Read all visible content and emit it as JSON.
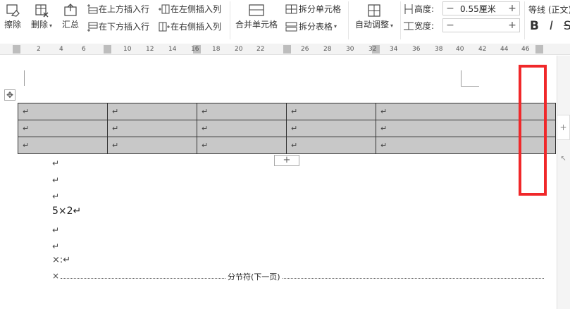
{
  "ribbon": {
    "erase": "擦除",
    "delete": "删除",
    "summary": "汇总",
    "insert_row_above": "在上方插入行",
    "insert_row_below": "在下方插入行",
    "insert_col_left": "在左侧插入列",
    "insert_col_right": "在右侧插入列",
    "merge_cells": "合并单元格",
    "split_cells": "拆分单元格",
    "split_table": "拆分表格",
    "auto_adjust": "自动调整",
    "height_label": "高度:",
    "height_value": "0.55厘米",
    "width_label": "宽度:",
    "width_value": "",
    "font_name": "等线 (正文)",
    "bold": "B",
    "italic": "I",
    "strike": "S"
  },
  "ruler": {
    "ticks": [
      "2",
      "4",
      "6",
      "10",
      "12",
      "14",
      "16",
      "18",
      "20",
      "22",
      "26",
      "28",
      "30",
      "32",
      "34",
      "36",
      "38",
      "40",
      "42",
      "44",
      "46"
    ]
  },
  "document": {
    "paragraph_mark": "↵",
    "table": {
      "rows": 3,
      "cols": 5,
      "cells": [
        [
          "↵",
          "↵",
          "↵",
          "↵",
          "↵"
        ],
        [
          "↵",
          "↵",
          "↵",
          "↵",
          "↵"
        ],
        [
          "↵",
          "↵",
          "↵",
          "↵",
          "↵"
        ]
      ]
    },
    "paragraphs": [
      "↵",
      "↵",
      "↵",
      "5×2↵",
      "↵",
      "↵",
      "×:↵"
    ],
    "section_break_prefix": "×",
    "section_break_label": "分节符(下一页)",
    "add_row_symbol": "+",
    "table_move_symbol": "✥"
  },
  "colors": {
    "highlight": "#f0282a",
    "table_fill": "#c8c8c8"
  }
}
